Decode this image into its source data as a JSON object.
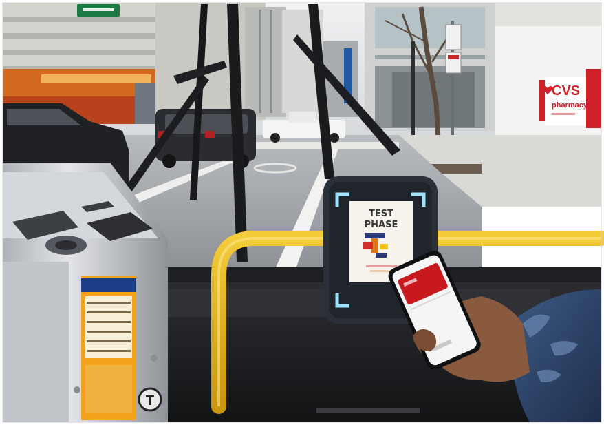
{
  "scene": {
    "description_free": true,
    "street_sign": "",
    "store_sign": {
      "brand": "CVS",
      "subline": "pharmacy"
    },
    "validator_screen": {
      "line1": "TEST",
      "line2": "PHASE"
    },
    "fare_box_logo": "T",
    "colors": {
      "sky": "#e9ecef",
      "grab_bar": "#e2b21a",
      "validator_body": "#2a2f38",
      "validator_light": "#9fe3ff",
      "cvs_red": "#d0202a",
      "fare_box_steel": "#c9ccd1",
      "fare_box_label": "#f2a21c",
      "phone_card": "#c8191f"
    }
  }
}
